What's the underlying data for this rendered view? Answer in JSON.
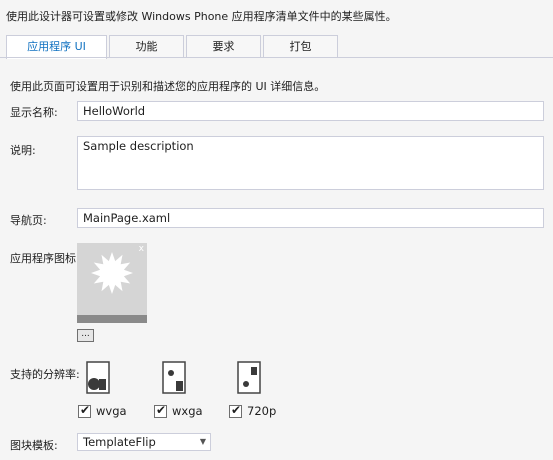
{
  "intro_text": "使用此设计器可设置或修改 Windows Phone 应用程序清单文件中的某些属性。",
  "tabs": [
    {
      "label": "应用程序 UI",
      "active": true
    },
    {
      "label": "功能",
      "active": false
    },
    {
      "label": "要求",
      "active": false
    },
    {
      "label": "打包",
      "active": false
    }
  ],
  "page_description": "使用此页面可设置用于识别和描述您的应用程序的 UI 详细信息。",
  "display_name": {
    "label": "显示名称:",
    "value": "HelloWorld"
  },
  "description": {
    "label": "说明:",
    "value": "Sample description"
  },
  "navigation_page": {
    "label": "导航页:",
    "value": "MainPage.xaml"
  },
  "app_icon": {
    "label": "应用程序图标:",
    "remove_glyph": "x",
    "browse_label": "..."
  },
  "resolutions": {
    "label": "支持的分辨率:",
    "items": [
      {
        "label": "wvga",
        "checked": true
      },
      {
        "label": "wxga",
        "checked": true
      },
      {
        "label": "720p",
        "checked": true
      }
    ]
  },
  "tile_template": {
    "label": "图块模板:",
    "value": "TemplateFlip"
  },
  "colors": {
    "accent": "#0e70c0",
    "border": "#cccedb",
    "background": "#f5f5f5"
  }
}
